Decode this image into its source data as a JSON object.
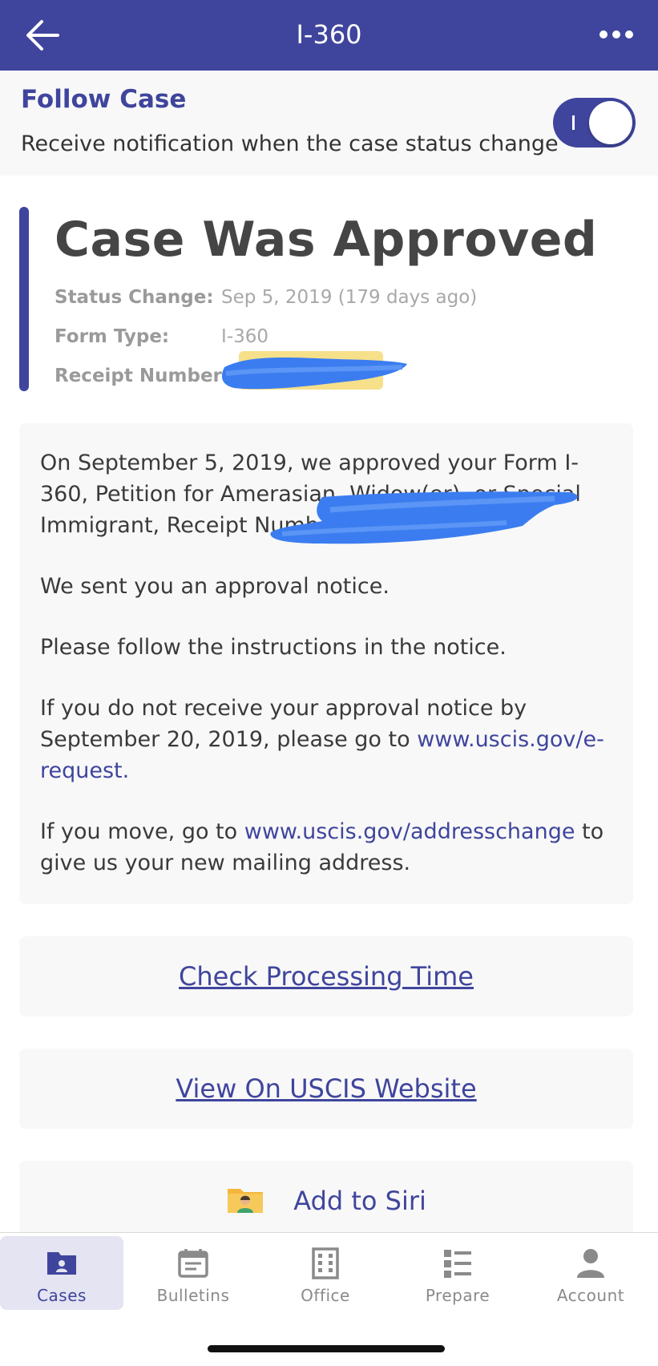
{
  "header": {
    "title": "I-360"
  },
  "follow": {
    "title": "Follow Case",
    "description": "Receive notification when the case status change",
    "enabled": true
  },
  "status": {
    "heading": "Case Was Approved",
    "rows": [
      {
        "label": "Status Change:",
        "value": "Sep 5, 2019 (179 days ago)"
      },
      {
        "label": "Form Type:",
        "value": "I-360"
      },
      {
        "label": "Receipt Number:",
        "value": ""
      }
    ]
  },
  "message": {
    "p1": "On September 5, 2019, we approved your Form I-360, Petition for Amerasian, Widow(er), or Special Immigrant, Receipt Number",
    "p2": "We sent you an approval notice.",
    "p3": "Please follow the instructions in the notice.",
    "p4_text": "If you do not receive your approval notice by September 20, 2019, please go to ",
    "p4_link": "www.uscis.gov/e-request.",
    "p5_text": "If you move, go to ",
    "p5_link": "www.uscis.gov/addresschange",
    "p5_tail": "  to give us your new mailing address."
  },
  "actions": {
    "processing_time": "Check Processing Time",
    "view_website": "View On USCIS Website",
    "add_siri": "Add to Siri"
  },
  "tabs": [
    {
      "label": "Cases",
      "icon": "briefcase-icon",
      "active": true
    },
    {
      "label": "Bulletins",
      "icon": "calendar-icon",
      "active": false
    },
    {
      "label": "Office",
      "icon": "building-icon",
      "active": false
    },
    {
      "label": "Prepare",
      "icon": "list-icon",
      "active": false
    },
    {
      "label": "Account",
      "icon": "person-icon",
      "active": false
    }
  ],
  "colors": {
    "primary": "#3f459d",
    "redaction": "#3b7df0",
    "highlight": "#f7e08a"
  }
}
